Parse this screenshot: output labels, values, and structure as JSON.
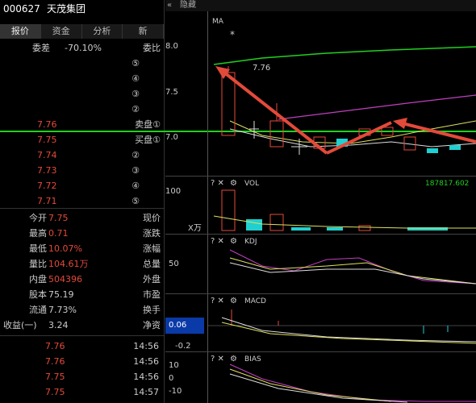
{
  "header": {
    "code": "000627",
    "name": "天茂集团"
  },
  "tabs": [
    "报价",
    "资金",
    "分析",
    "新"
  ],
  "weibi": {
    "label": "委比",
    "value": "-70.10%",
    "label2": "委差"
  },
  "sell_levels": [
    {
      "label": "⑤",
      "price": ""
    },
    {
      "label": "④",
      "price": ""
    },
    {
      "label": "③",
      "price": ""
    },
    {
      "label": "②",
      "price": ""
    },
    {
      "label": "卖盘①",
      "price": "7.76"
    }
  ],
  "buy_levels": [
    {
      "label": "买盘①",
      "price": "7.75"
    },
    {
      "label": "②",
      "price": "7.74"
    },
    {
      "label": "③",
      "price": "7.73"
    },
    {
      "label": "④",
      "price": "7.72"
    },
    {
      "label": "⑤",
      "price": "7.71"
    }
  ],
  "stats": [
    {
      "label": "现价",
      "value": "7.75",
      "label2": "今开"
    },
    {
      "label": "涨跌",
      "value": "0.71",
      "label2": "最高"
    },
    {
      "label": "涨幅",
      "value": "10.07%",
      "label2": "最低"
    },
    {
      "label": "总量",
      "value": "104.61万",
      "label2": "量比"
    },
    {
      "label": "外盘",
      "value": "504396",
      "label2": "内盘"
    },
    {
      "label": "市盈",
      "value": "75.19",
      "label2": "股本"
    },
    {
      "label": "换手",
      "value": "7.73%",
      "label2": "流通"
    },
    {
      "label": "净资",
      "value": "3.24",
      "label2": "收益(一)"
    }
  ],
  "ticks": [
    {
      "time": "14:56",
      "price": "7.76"
    },
    {
      "time": "14:56",
      "price": "7.76"
    },
    {
      "time": "14:56",
      "price": "7.75"
    },
    {
      "time": "14:57",
      "price": "7.75"
    }
  ],
  "chart_top": {
    "hide_label": "隐藏",
    "ma_label": "MA",
    "price_label": "7.76",
    "y_ticks": [
      "8.0",
      "7.5",
      "7.0"
    ]
  },
  "vol_panel": {
    "name": "VOL",
    "right_value": "187817.602",
    "y_top": "100",
    "unit": "X万"
  },
  "kdj_panel": {
    "name": "KDJ",
    "y_mid": "50"
  },
  "macd_panel": {
    "name": "MACD",
    "value": "0.06",
    "y_bottom": "-0.2"
  },
  "bias_panel": {
    "name": "BIAS",
    "y_top": "10",
    "y_mid": "0",
    "y_bottom": "-10"
  },
  "colors": {
    "up": "#e34a3a",
    "down": "#20d0d0",
    "green_line": "#20d020",
    "purple": "#c040c0",
    "yellow": "#e0e060"
  }
}
